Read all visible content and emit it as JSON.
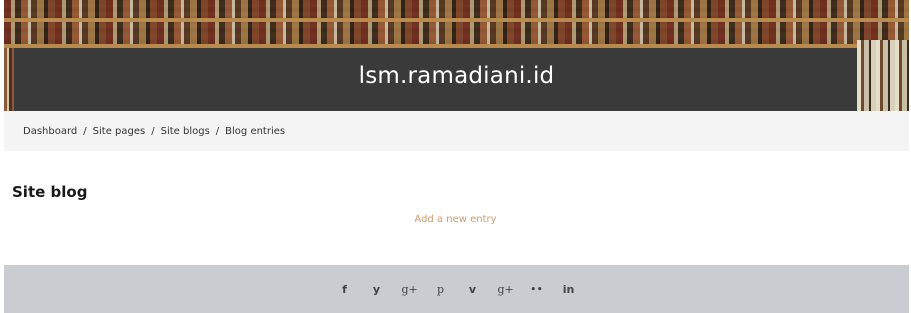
{
  "header": {
    "site_title": "lsm.ramadiani.id"
  },
  "breadcrumb": {
    "items": [
      "Dashboard",
      "Site pages",
      "Site blogs",
      "Blog entries"
    ],
    "separator": "/"
  },
  "main": {
    "title": "Site blog",
    "add_entry_label": "Add a new entry"
  },
  "footer": {
    "social_icons": [
      {
        "name": "facebook-icon",
        "glyph": "f"
      },
      {
        "name": "twitter-icon",
        "glyph": "y"
      },
      {
        "name": "google-plus-icon",
        "glyph": "g+"
      },
      {
        "name": "pinterest-icon",
        "glyph": "p"
      },
      {
        "name": "vimeo-icon",
        "glyph": "v"
      },
      {
        "name": "google-icon",
        "glyph": "g+"
      },
      {
        "name": "flickr-icon",
        "glyph": "••"
      },
      {
        "name": "linkedin-icon",
        "glyph": "in"
      }
    ]
  },
  "colors": {
    "header_band": "#3a3a3a",
    "breadcrumb_bg": "#f4f4f4",
    "link_accent": "#d19a66",
    "footer_bg": "#c9cdd1"
  }
}
